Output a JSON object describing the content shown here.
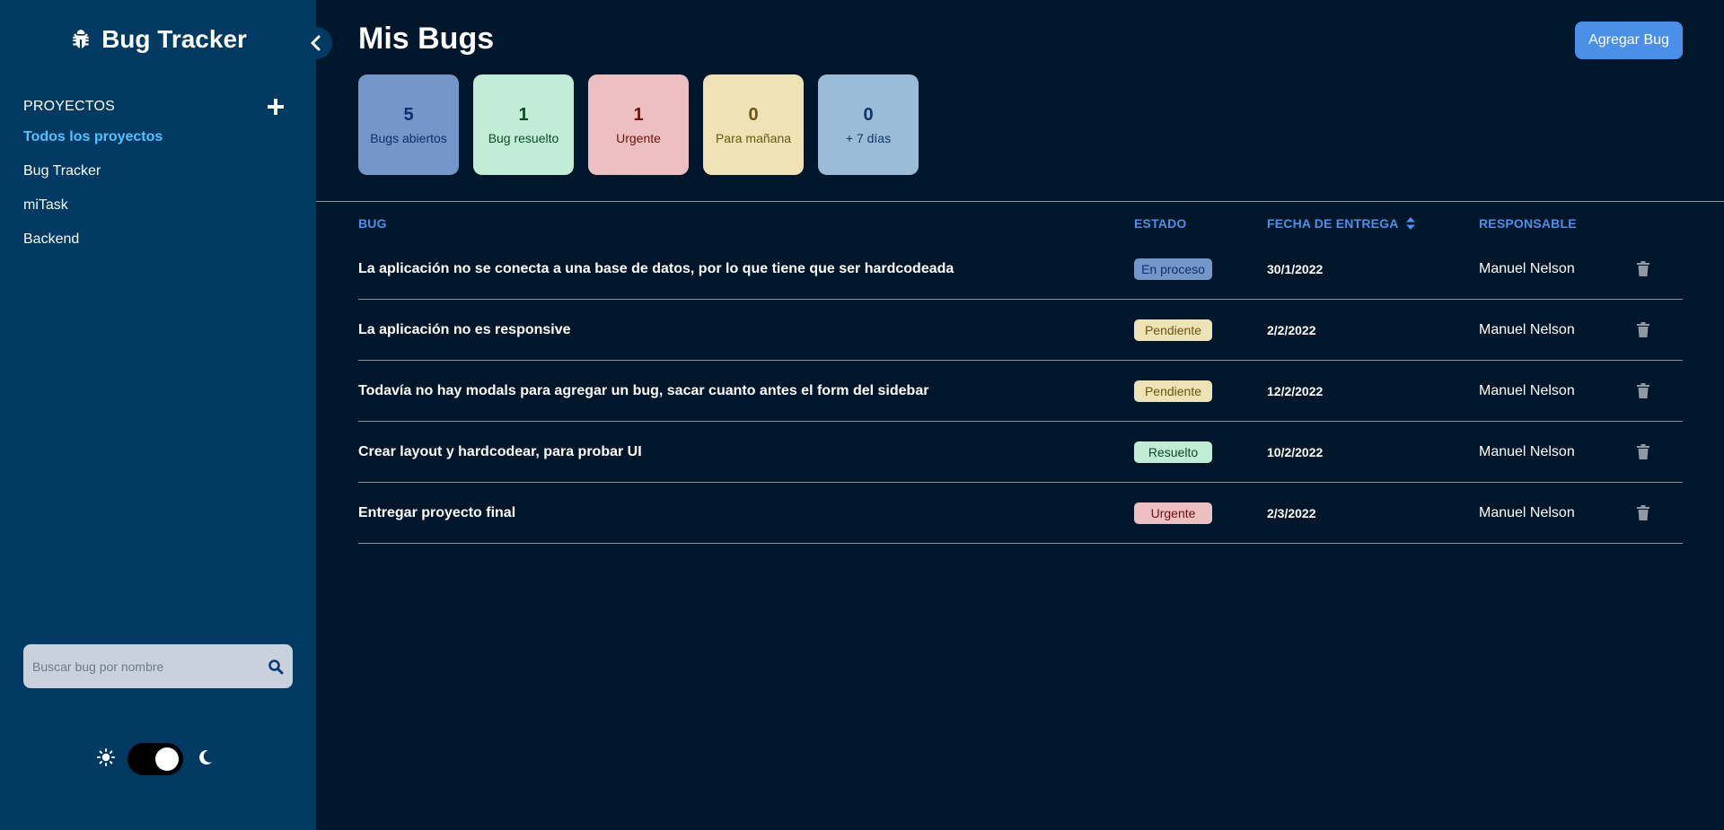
{
  "sidebar": {
    "brand": "Bug Tracker",
    "projects_label": "PROYECTOS",
    "projects": [
      {
        "label": "Todos los proyectos",
        "active": true
      },
      {
        "label": "Bug Tracker",
        "active": false
      },
      {
        "label": "miTask",
        "active": false
      },
      {
        "label": "Backend",
        "active": false
      }
    ],
    "search_placeholder": "Buscar bug por nombre",
    "theme": "dark"
  },
  "main": {
    "title": "Mis Bugs",
    "add_button": "Agregar Bug",
    "stats": [
      {
        "value": "5",
        "label": "Bugs abiertos",
        "bg": "#7496c8",
        "fg": "#0b2f6b"
      },
      {
        "value": "1",
        "label": "Bug resuelto",
        "bg": "#c1ecd6",
        "fg": "#0f4a2a"
      },
      {
        "value": "1",
        "label": "Urgente",
        "bg": "#ecc0c0",
        "fg": "#6b1212"
      },
      {
        "value": "0",
        "label": "Para mañana",
        "bg": "#eee3b5",
        "fg": "#6a5610"
      },
      {
        "value": "0",
        "label": "+ 7 días",
        "bg": "#9bbcd6",
        "fg": "#0f3763"
      }
    ],
    "table": {
      "headers": {
        "bug": "BUG",
        "estado": "ESTADO",
        "fecha": "FECHA DE ENTREGA",
        "responsable": "RESPONSABLE"
      },
      "rows": [
        {
          "bug": "La aplicación no se conecta a una base de datos, por lo que tiene que ser hardcodeada",
          "estado": "En proceso",
          "fecha": "30/1/2022",
          "responsable": "Manuel Nelson"
        },
        {
          "bug": "La aplicación no es responsive",
          "estado": "Pendiente",
          "fecha": "2/2/2022",
          "responsable": "Manuel Nelson"
        },
        {
          "bug": "Todavía no hay modals para agregar un bug, sacar cuanto antes el form del sidebar",
          "estado": "Pendiente",
          "fecha": "12/2/2022",
          "responsable": "Manuel Nelson"
        },
        {
          "bug": "Crear layout y hardcodear, para probar UI",
          "estado": "Resuelto",
          "fecha": "10/2/2022",
          "responsable": "Manuel Nelson"
        },
        {
          "bug": "Entregar proyecto final",
          "estado": "Urgente",
          "fecha": "2/3/2022",
          "responsable": "Manuel Nelson"
        }
      ]
    },
    "status_colors": {
      "En proceso": {
        "bg": "#7496c8",
        "fg": "#0b2f6b"
      },
      "Pendiente": {
        "bg": "#eee3b5",
        "fg": "#6a5610"
      },
      "Resuelto": {
        "bg": "#c1ecd6",
        "fg": "#0f4a2a"
      },
      "Urgente": {
        "bg": "#ecc0c0",
        "fg": "#6b1212"
      }
    }
  }
}
